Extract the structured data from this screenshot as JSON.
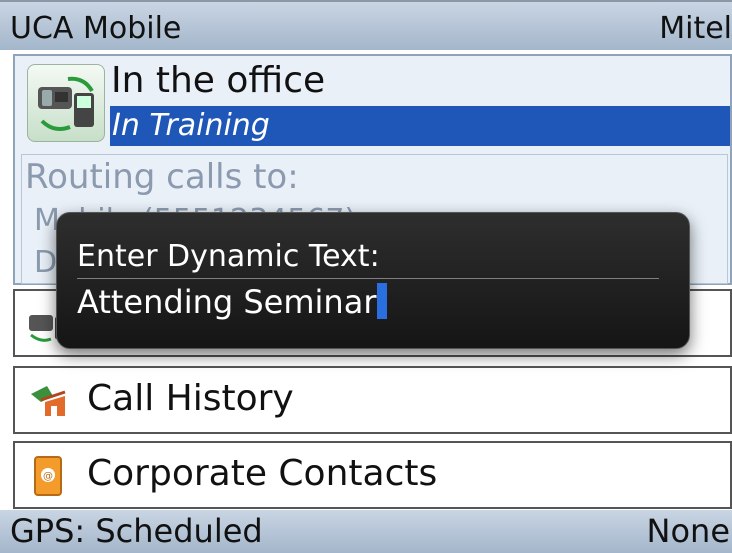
{
  "app": {
    "title": "UCA Mobile",
    "carrier": "Mitel"
  },
  "status": {
    "title": "In the office",
    "subtitle": "In Training",
    "routing_label": "Routing calls to:",
    "routing_lines": [
      "Mobile (5551234567)",
      "Desk"
    ]
  },
  "menu": {
    "items": [
      {
        "label": "Call History",
        "icon": "call-history-icon"
      },
      {
        "label": "Corporate Contacts",
        "icon": "contacts-book-icon"
      }
    ]
  },
  "dialog": {
    "prompt": "Enter Dynamic Text:",
    "value": "Attending Seminar"
  },
  "footer": {
    "gps": "GPS: Scheduled",
    "value": "None"
  }
}
